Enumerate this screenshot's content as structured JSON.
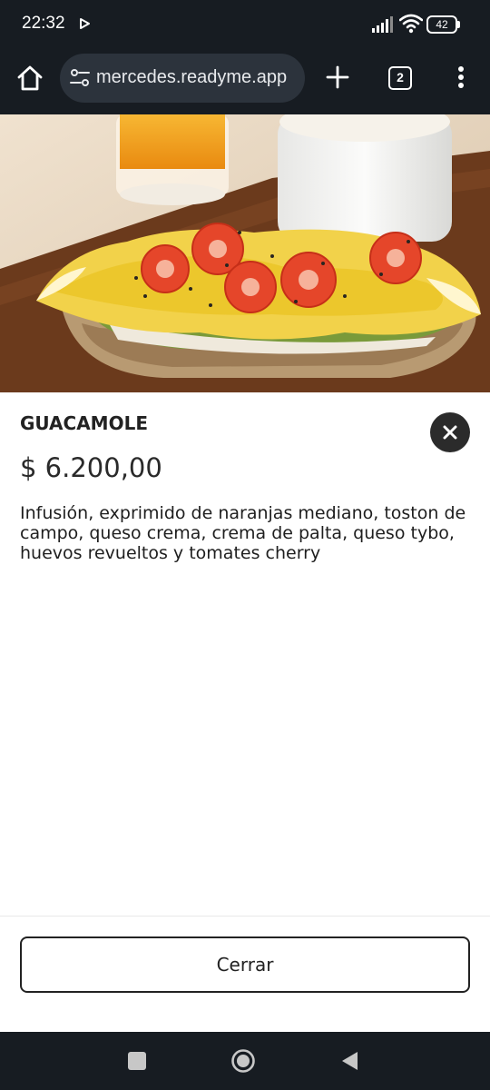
{
  "status_bar": {
    "time": "22:32",
    "battery": "42",
    "icons": [
      "play-icon",
      "signal-icon",
      "wifi-icon",
      "battery-icon"
    ]
  },
  "browser": {
    "url": "mercedes.readyme.app",
    "tab_count": "2",
    "icons": [
      "home-icon",
      "tune-icon",
      "plus-icon",
      "more-vert-icon"
    ]
  },
  "product": {
    "name": "GUACAMOLE",
    "price": "$ 6.200,00",
    "description": "Infusión, exprimido de naranjas mediano, toston de campo, queso crema, crema de palta, queso tybo, huevos revueltos y tomates cherry",
    "image_subject": "toast with scrambled eggs, guacamole and cherry tomatoes"
  },
  "footer": {
    "close_label": "Cerrar"
  },
  "nav": {
    "icons": [
      "recents-icon",
      "home-circle-icon",
      "back-icon"
    ]
  },
  "colors": {
    "system_bar": "#171c22",
    "url_box": "#2c333c",
    "sheet_bg": "#ffffff",
    "close_circle": "#2b2b2b"
  }
}
